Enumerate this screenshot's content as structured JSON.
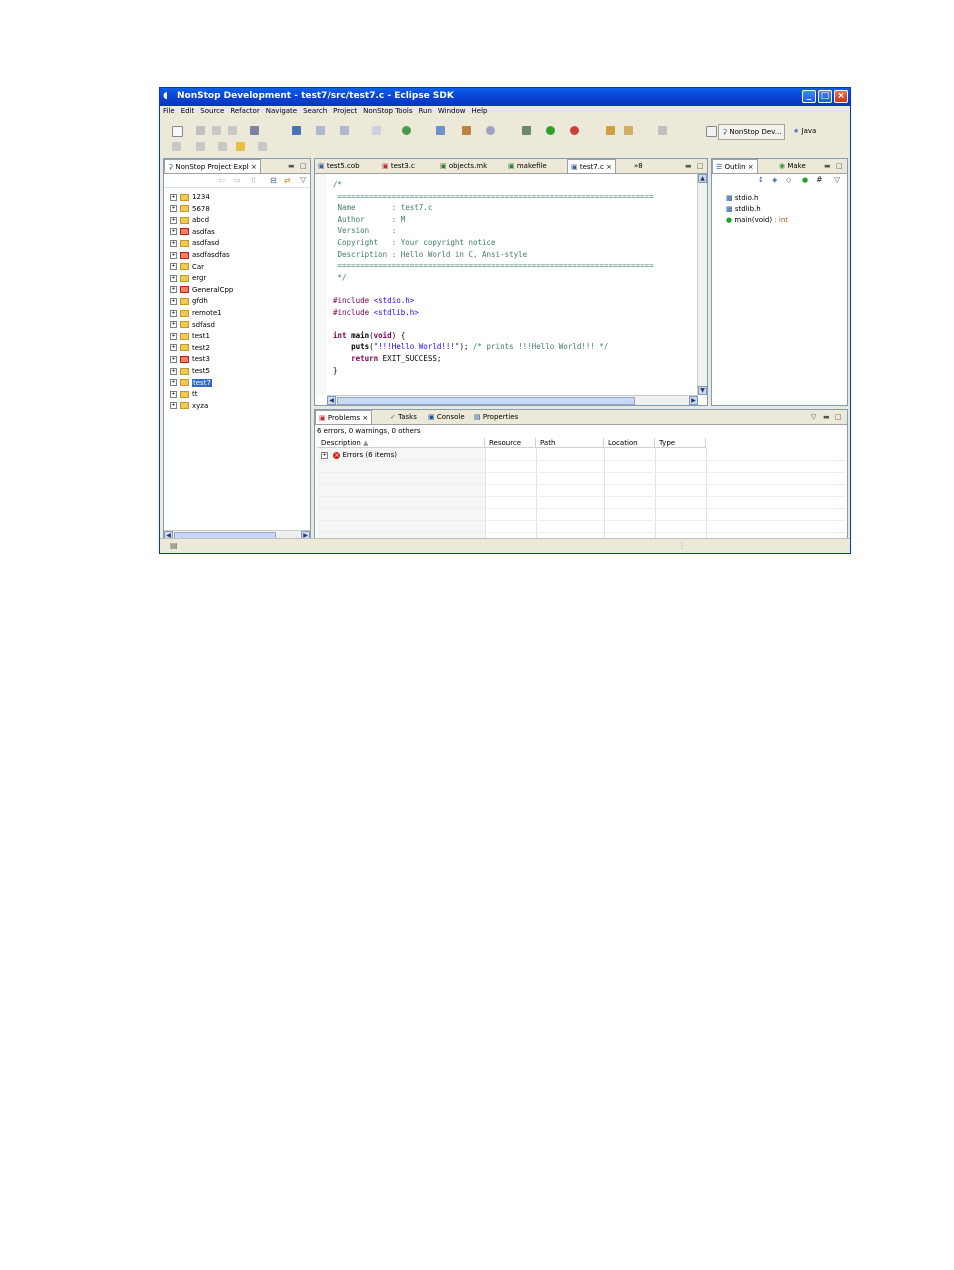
{
  "window": {
    "title": "NonStop Development - test7/src/test7.c - Eclipse SDK",
    "controls": [
      "minimize",
      "maximize",
      "close"
    ]
  },
  "menu": [
    "File",
    "Edit",
    "Source",
    "Refactor",
    "Navigate",
    "Search",
    "Project",
    "NonStop Tools",
    "Run",
    "Window",
    "Help"
  ],
  "perspectives": {
    "active": "NonStop Dev...",
    "other": "Java"
  },
  "project_explorer": {
    "tab_label": "NonStop Project Expl",
    "items": [
      {
        "name": "1234",
        "error": false
      },
      {
        "name": "5678",
        "error": false
      },
      {
        "name": "abcd",
        "error": false
      },
      {
        "name": "asdfas",
        "error": true
      },
      {
        "name": "asdfasd",
        "error": false
      },
      {
        "name": "asdfasdfas",
        "error": true
      },
      {
        "name": "Car",
        "error": false
      },
      {
        "name": "ergr",
        "error": false
      },
      {
        "name": "GeneralCpp",
        "error": true
      },
      {
        "name": "gfdh",
        "error": false
      },
      {
        "name": "remote1",
        "error": false
      },
      {
        "name": "sdfasd",
        "error": false
      },
      {
        "name": "test1",
        "error": false
      },
      {
        "name": "test2",
        "error": false
      },
      {
        "name": "test3",
        "error": true
      },
      {
        "name": "test5",
        "error": false
      },
      {
        "name": "test7",
        "error": false,
        "selected": true
      },
      {
        "name": "tt",
        "error": false
      },
      {
        "name": "xyza",
        "error": false
      }
    ]
  },
  "editor": {
    "tabs": [
      "test5.cob",
      "test3.c",
      "objects.mk",
      "makefile",
      "test7.c"
    ],
    "active_tab": "test7.c",
    "overflow_count": "8",
    "code_lines": [
      "/*",
      " ======================================================================",
      " Name        : test7.c",
      " Author      : M",
      " Version     :",
      " Copyright   : Your copyright notice",
      " Description : Hello World in C, Ansi-style",
      " ======================================================================",
      " */",
      "",
      "#include <stdio.h>",
      "#include <stdlib.h>",
      "",
      "int main(void) {",
      "    puts(\"!!!Hello World!!!\"); /* prints !!!Hello World!!! */",
      "    return EXIT_SUCCESS;",
      "}"
    ]
  },
  "outline": {
    "tabs": [
      "Outlin",
      "Make"
    ],
    "items": [
      {
        "label": "stdio.h",
        "type": ""
      },
      {
        "label": "stdlib.h",
        "type": ""
      },
      {
        "label": "main(void)",
        "type": " : int"
      }
    ]
  },
  "bottom_panel": {
    "tabs": [
      "Problems",
      "Tasks",
      "Console",
      "Properties"
    ],
    "summary": "6 errors, 0 warnings, 0 others",
    "columns": [
      "Description",
      "Resource",
      "Path",
      "Location",
      "Type"
    ],
    "rows": [
      {
        "description": "Errors (6 items)"
      }
    ]
  },
  "colors": {
    "titlebar": "#0a4fd8",
    "selection": "#316ac5",
    "keyword": "#7f0055",
    "comment": "#3f7f5f",
    "string": "#2a00ff"
  }
}
